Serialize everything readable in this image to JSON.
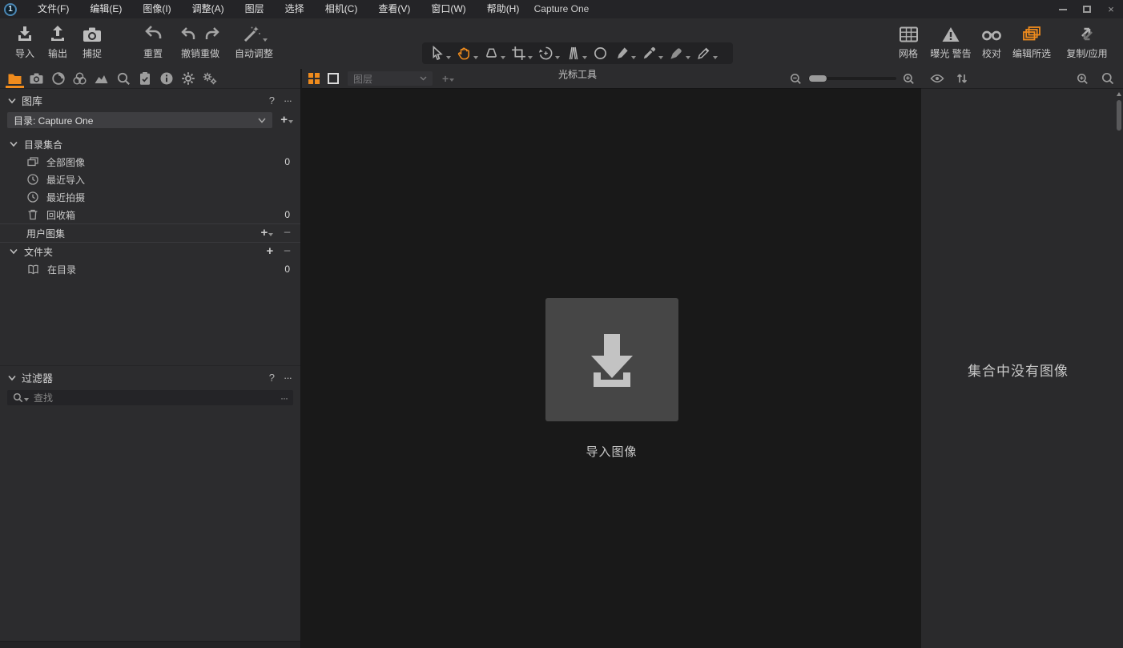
{
  "colors": {
    "accent_orange": "#ef8b1d",
    "panel_bg": "#2c2c2e",
    "viewer_bg": "#191919",
    "browser_bg": "#2a2a2c",
    "menubar_bg": "#242427",
    "tile_bg": "#464646"
  },
  "icons": {
    "logo": "circle-with-1",
    "minimize": "horizontal-line-shape",
    "maximize": "square-outline-shape",
    "close_glyph": "×",
    "help_glyph": "?",
    "more_glyph": "···",
    "add_glyph": "+",
    "remove_glyph": "−",
    "logo_glyph": "1"
  },
  "menubar": {
    "app_title": "Capture One",
    "items": [
      "文件(F)",
      "编辑(E)",
      "图像(I)",
      "调整(A)",
      "图层",
      "选择",
      "相机(C)",
      "查看(V)",
      "窗口(W)",
      "帮助(H)"
    ]
  },
  "toolbar": {
    "import_label": "导入",
    "output_label": "输出",
    "capture_label": "捕捉",
    "reset_label": "重置",
    "undo_redo_label": "撤销重做",
    "auto_adjust_label": "自动调整",
    "cursor_tools_label": "光标工具",
    "grid_label": "网格",
    "exposure_warning_label": "曝光 警告",
    "proof_label": "校对",
    "edit_selected_label": "编辑所选",
    "copy_apply_label": "复制/应用"
  },
  "library": {
    "title": "图库",
    "help_glyph": "?",
    "more_glyph": "···",
    "add_glyph": "+",
    "catalog_dropdown": "目录: Capture One",
    "catalog_section_label": "目录集合",
    "rows": [
      {
        "label": "全部图像",
        "count": "0"
      },
      {
        "label": "最近导入",
        "count": ""
      },
      {
        "label": "最近拍摄",
        "count": ""
      },
      {
        "label": "回收箱",
        "count": "0"
      }
    ],
    "user_collections": {
      "label": "用户图集",
      "add_glyph": "+",
      "remove_glyph": "−"
    },
    "folders": {
      "label": "文件夹",
      "add_glyph": "+",
      "remove_glyph": "−"
    },
    "folder_rows": [
      {
        "label": "在目录",
        "count": "0"
      }
    ]
  },
  "filters": {
    "title": "过滤器",
    "help_glyph": "?",
    "more_glyph": "···",
    "search_placeholder": "查找",
    "search_more_glyph": "···"
  },
  "viewer": {
    "layers_dropdown": "图层",
    "import_tile_label": "导入图像"
  },
  "browser": {
    "empty_message": "集合中没有图像"
  }
}
